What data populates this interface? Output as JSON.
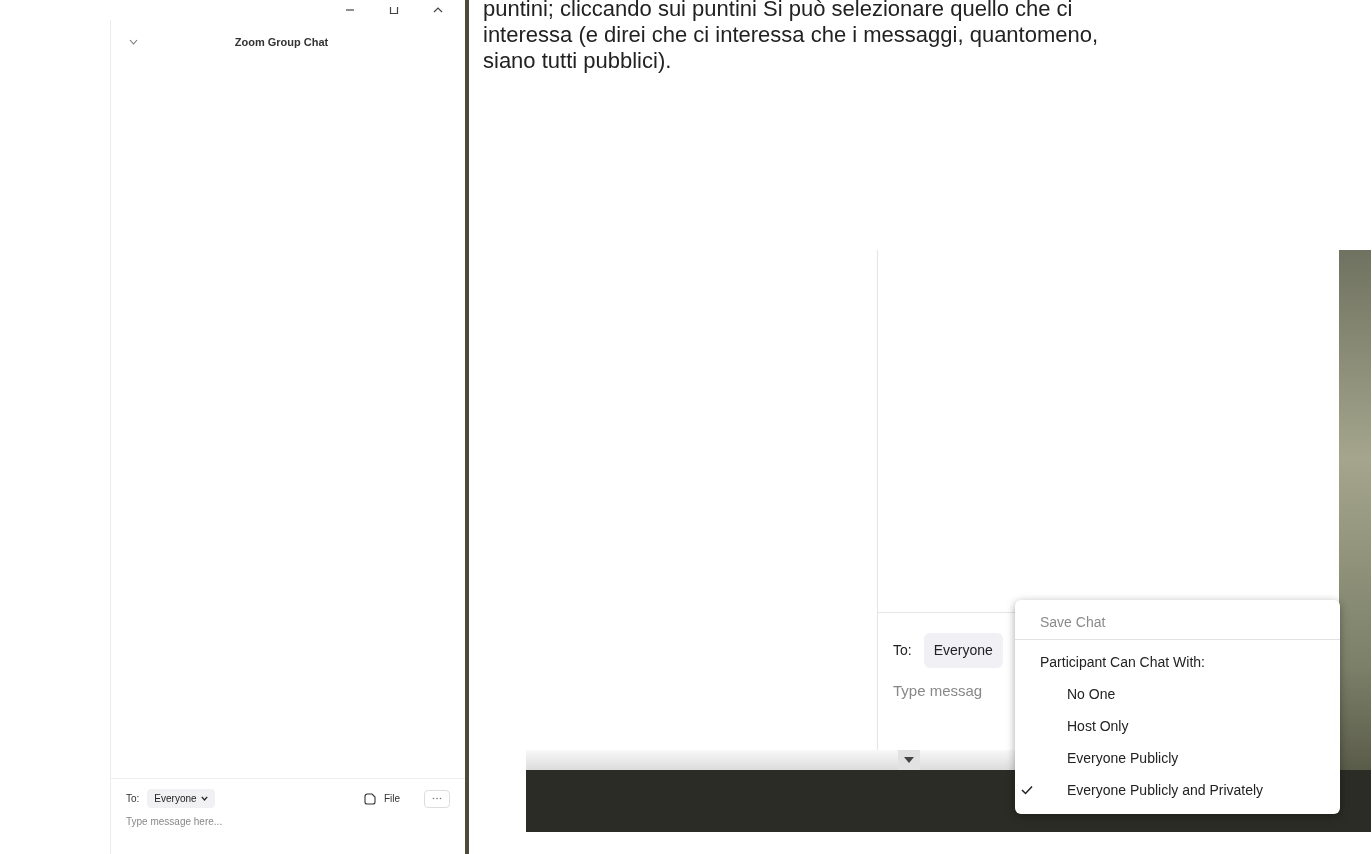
{
  "chat_window": {
    "title": "Zoom Group Chat",
    "to_label": "To:",
    "recipient": "Everyone",
    "file_label": "File",
    "message": {
      "placeholder": "Type message here..."
    }
  },
  "paragraph": {
    "lines": [
      "puntini; cliccando sui puntini Si può selezionare quello che ci",
      "interessa (e direi che ci interessa che i messaggi, quantomeno,",
      "siano tutti pubblici)."
    ]
  },
  "screenshot": {
    "to_label": "To:",
    "recipient": "Everyone",
    "message_text": "Type messag",
    "menu": [
      {
        "kind": "action",
        "label": "Save Chat",
        "disabled": true
      },
      {
        "kind": "header",
        "label": "Participant Can Chat With:"
      },
      {
        "kind": "option",
        "label": "No One",
        "checked": false
      },
      {
        "kind": "option",
        "label": "Host Only",
        "checked": false
      },
      {
        "kind": "option",
        "label": "Everyone Publicly",
        "checked": false
      },
      {
        "kind": "option",
        "label": "Everyone Publicly and Privately",
        "checked": true
      }
    ]
  }
}
